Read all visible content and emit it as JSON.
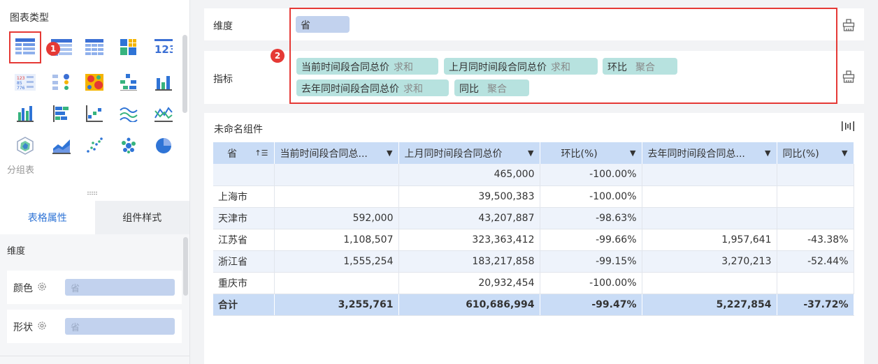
{
  "left_panel": {
    "chart_type_title": "图表类型",
    "group_label": "分组表",
    "icons": [
      "grouped-table-icon",
      "cross-table-icon",
      "detail-table-icon",
      "heatmap-grid-icon",
      "kpi-number-icon",
      "multi-kpi-icon",
      "legend-table-icon",
      "heatmap-icon",
      "waterfall-icon",
      "bar-chart-icon",
      "column-chart-icon",
      "horizontal-bar-icon",
      "scatter-step-icon",
      "wave-line-icon",
      "multi-line-icon",
      "radar-icon",
      "area-chart-icon",
      "scatter-icon",
      "bubble-icon",
      "pie-chart-icon"
    ],
    "tabs": [
      "表格属性",
      "组件样式"
    ],
    "props_dim_label": "维度",
    "props": [
      {
        "label": "颜色",
        "value": "省"
      },
      {
        "label": "形状",
        "value": "省"
      }
    ],
    "badge1": "1"
  },
  "config": {
    "dimension_label": "维度",
    "dimension_pill": "省",
    "metric_label": "指标",
    "badge2": "2",
    "metrics": [
      {
        "name": "当前时间段合同总价",
        "agg": "求和"
      },
      {
        "name": "上月同时间段合同总价",
        "agg": "求和"
      },
      {
        "name": "环比",
        "agg": "聚合"
      },
      {
        "name": "去年同时间段合同总价",
        "agg": "求和"
      },
      {
        "name": "同比",
        "agg": "聚合"
      }
    ]
  },
  "widget": {
    "title": "未命名组件",
    "headers": [
      "省",
      "当前时间段合同总...",
      "上月同时间段合同总价",
      "环比(%)",
      "去年同时间段合同总...",
      "同比(%)"
    ],
    "rows": [
      [
        "",
        "",
        "465,000",
        "-100.00%",
        "",
        ""
      ],
      [
        "上海市",
        "",
        "39,500,383",
        "-100.00%",
        "",
        ""
      ],
      [
        "天津市",
        "592,000",
        "43,207,887",
        "-98.63%",
        "",
        ""
      ],
      [
        "江苏省",
        "1,108,507",
        "323,363,412",
        "-99.66%",
        "1,957,641",
        "-43.38%"
      ],
      [
        "浙江省",
        "1,555,254",
        "183,217,858",
        "-99.15%",
        "3,270,213",
        "-52.44%"
      ],
      [
        "重庆市",
        "",
        "20,932,454",
        "-100.00%",
        "",
        ""
      ]
    ],
    "total": [
      "合计",
      "3,255,761",
      "610,686,994",
      "-99.47%",
      "5,227,854",
      "-37.72%"
    ]
  }
}
